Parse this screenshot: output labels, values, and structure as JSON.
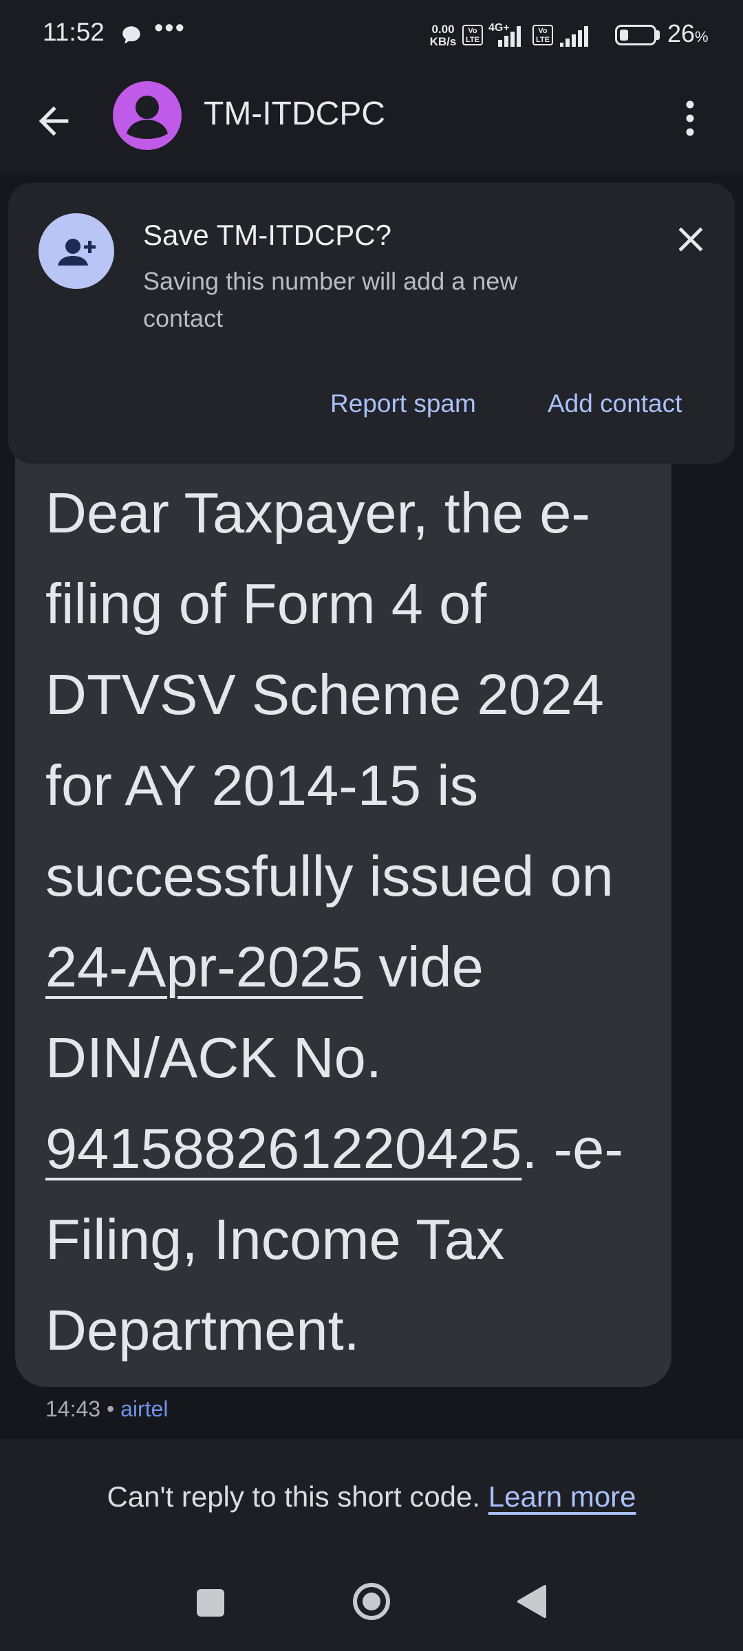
{
  "status_bar": {
    "time": "11:52",
    "net_speed_value": "0.00",
    "net_speed_unit": "KB/s",
    "volte_1": "Vo LTE",
    "network_1": "4G+",
    "volte_2": "Vo LTE",
    "battery_percent": "26",
    "battery_symbol": "%",
    "battery_level": 0.26
  },
  "header": {
    "title": "TM-ITDCPC"
  },
  "save_card": {
    "title": "Save TM-ITDCPC?",
    "subtitle": "Saving this number will add a new contact",
    "report_spam_label": "Report spam",
    "add_contact_label": "Add contact"
  },
  "message": {
    "text_part1": "Dear Taxpayer, the e-filing of Form 4 of DTVSV Scheme 2024 for AY 2014-15 is successfully issued on ",
    "date_link": "24-Apr-2025",
    "text_part2": " vide DIN/ACK No. ",
    "ack_link": "941588261220425",
    "text_part3": ". -e-Filing, Income Tax Department.",
    "time": "14:43",
    "separator": "•",
    "carrier": "airtel"
  },
  "footer": {
    "cant_reply_text": "Can't reply to this short code.",
    "learn_more_label": "Learn more"
  },
  "colors": {
    "background": "#15171c",
    "avatar": "#c05ae8",
    "accent": "#a9c0fb",
    "bubble": "#303238"
  }
}
